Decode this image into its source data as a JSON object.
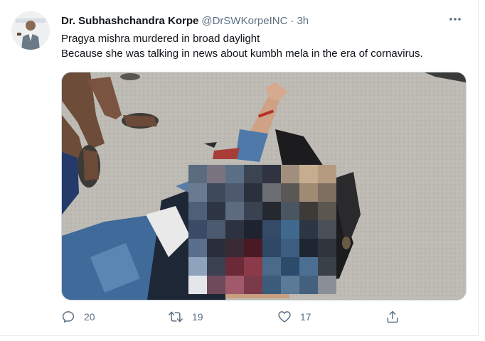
{
  "tweet": {
    "author": {
      "display_name": "Dr. Subhashchandra Korpe",
      "handle": "@DrSWKorpeINC",
      "separator": "·",
      "time": "3h"
    },
    "text_lines": [
      "Pragya mishra murdered in broad daylight",
      "Because she was talking in news about kumbh mela in the era of cornavirus."
    ],
    "media": {
      "kind": "photo",
      "pixelated_region": true
    },
    "actions": {
      "reply": {
        "icon": "reply-icon",
        "count": "20"
      },
      "retweet": {
        "icon": "retweet-icon",
        "count": "19"
      },
      "like": {
        "icon": "heart-icon",
        "count": "17"
      },
      "share": {
        "icon": "share-icon"
      }
    }
  },
  "colors": {
    "text_primary": "#0f1419",
    "text_secondary": "#5b7083",
    "border": "#cfd9de"
  }
}
